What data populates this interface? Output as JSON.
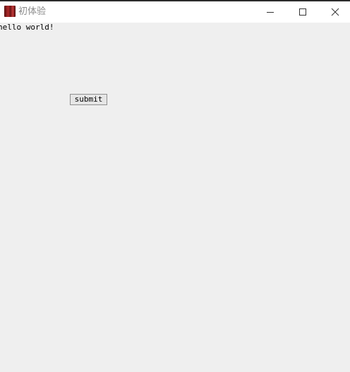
{
  "window": {
    "title": "初体验",
    "icon": "app-icon"
  },
  "title_controls": {
    "minimize_icon": "minimize-icon",
    "maximize_icon": "maximize-icon",
    "close_icon": "close-icon"
  },
  "content": {
    "label_text": "hello world!",
    "submit_label": "submit"
  },
  "colors": {
    "titlebar_bg": "#ffffff",
    "content_bg": "#efefef",
    "title_text": "#8a8a8a",
    "button_bg": "#e6e6e6",
    "button_border": "#8f8f8f"
  }
}
